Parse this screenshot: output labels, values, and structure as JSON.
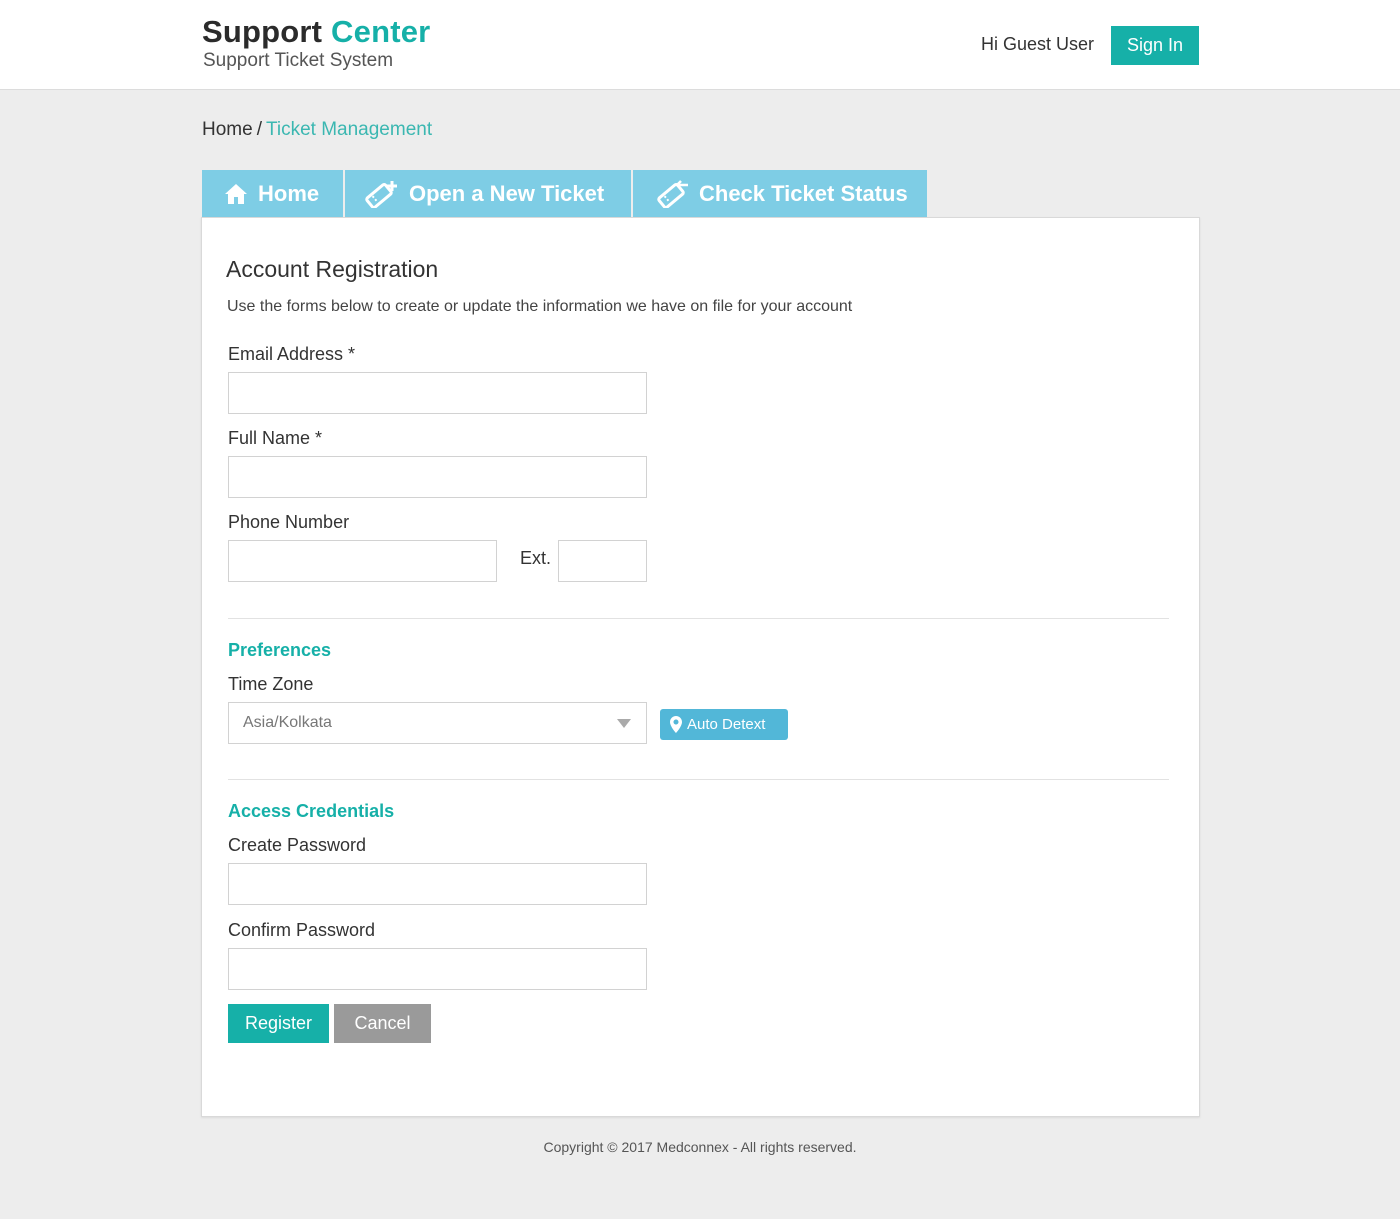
{
  "header": {
    "brand_main": "Support",
    "brand_accent": "Center",
    "brand_subtitle": "Support Ticket System",
    "greeting": "Hi Guest User",
    "signin_label": "Sign In"
  },
  "breadcrumb": {
    "home": "Home",
    "separator": "/",
    "current": "Ticket Management"
  },
  "tabs": [
    {
      "label": "Home",
      "icon": "home-icon"
    },
    {
      "label": "Open a New Ticket",
      "icon": "ticket-plus-icon"
    },
    {
      "label": "Check Ticket Status",
      "icon": "ticket-arrow-icon"
    }
  ],
  "form": {
    "title": "Account Registration",
    "description": "Use the forms below to create or update the information we have on file for your account",
    "email_label": "Email Address *",
    "email_value": "",
    "fullname_label": "Full Name *",
    "fullname_value": "",
    "phone_label": "Phone Number",
    "phone_value": "",
    "ext_label": "Ext.",
    "ext_value": "",
    "preferences_heading": "Preferences",
    "timezone_label": "Time Zone",
    "timezone_value": "Asia/Kolkata",
    "autodetect_label": "Auto Detext",
    "credentials_heading": "Access Credentials",
    "create_password_label": "Create Password",
    "confirm_password_label": "Confirm Password",
    "register_label": "Register",
    "cancel_label": "Cancel"
  },
  "footer": {
    "copyright": "Copyright © 2017 Medconnex - All rights reserved."
  },
  "colors": {
    "accent": "#16b0a8",
    "tab_bg": "#7ecde5",
    "autodetect_bg": "#52b7d8",
    "cancel_bg": "#9a9a9a",
    "page_bg": "#ededed"
  }
}
